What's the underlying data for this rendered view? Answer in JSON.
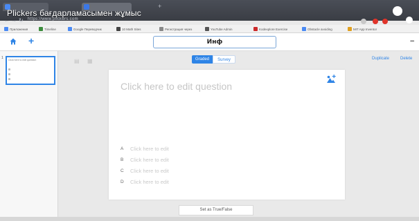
{
  "browser": {
    "video_title": "Plickers бағдарламасымен жұмыс",
    "url": "https://www.plickers.com",
    "bookmarks": [
      {
        "label": "Приложения",
        "color": "#4a8af4"
      },
      {
        "label": "Timeline",
        "color": "#3c8c3c"
      },
      {
        "label": "Google Переводчик",
        "color": "#4a8af4"
      },
      {
        "label": "10 Math Sites",
        "color": "#444444"
      },
      {
        "label": "Регистрация через",
        "color": "#888888"
      },
      {
        "label": "YouTube Admin",
        "color": "#555555"
      },
      {
        "label": "Kodexplore Exercise",
        "color": "#cc2a2a"
      },
      {
        "label": "Obstacle avoiding",
        "color": "#4a8af4"
      },
      {
        "label": "MIT App Inventor",
        "color": "#e0a020"
      }
    ]
  },
  "app": {
    "set_title": "Инф",
    "mode_tabs": [
      "Graded",
      "Survey"
    ],
    "actions": {
      "duplicate": "Duplicate",
      "delete": "Delete"
    },
    "sidebar": {
      "item_number": "1",
      "item_text": "Click here to edit question"
    }
  },
  "question": {
    "placeholder": "Click here to edit question",
    "answers": [
      {
        "letter": "A",
        "text": "Click here to edit"
      },
      {
        "letter": "B",
        "text": "Click here to edit"
      },
      {
        "letter": "C",
        "text": "Click here to edit"
      },
      {
        "letter": "D",
        "text": "Click here to edit"
      }
    ]
  },
  "footer": {
    "true_false_button": "Set as True/False"
  },
  "colors": {
    "accent": "#2e84e6",
    "titlebar": "#3a3d44"
  },
  "icons": [
    "home-icon",
    "plus-icon",
    "add-image-icon",
    "more-icon",
    "undo-icon",
    "redo-icon"
  ]
}
